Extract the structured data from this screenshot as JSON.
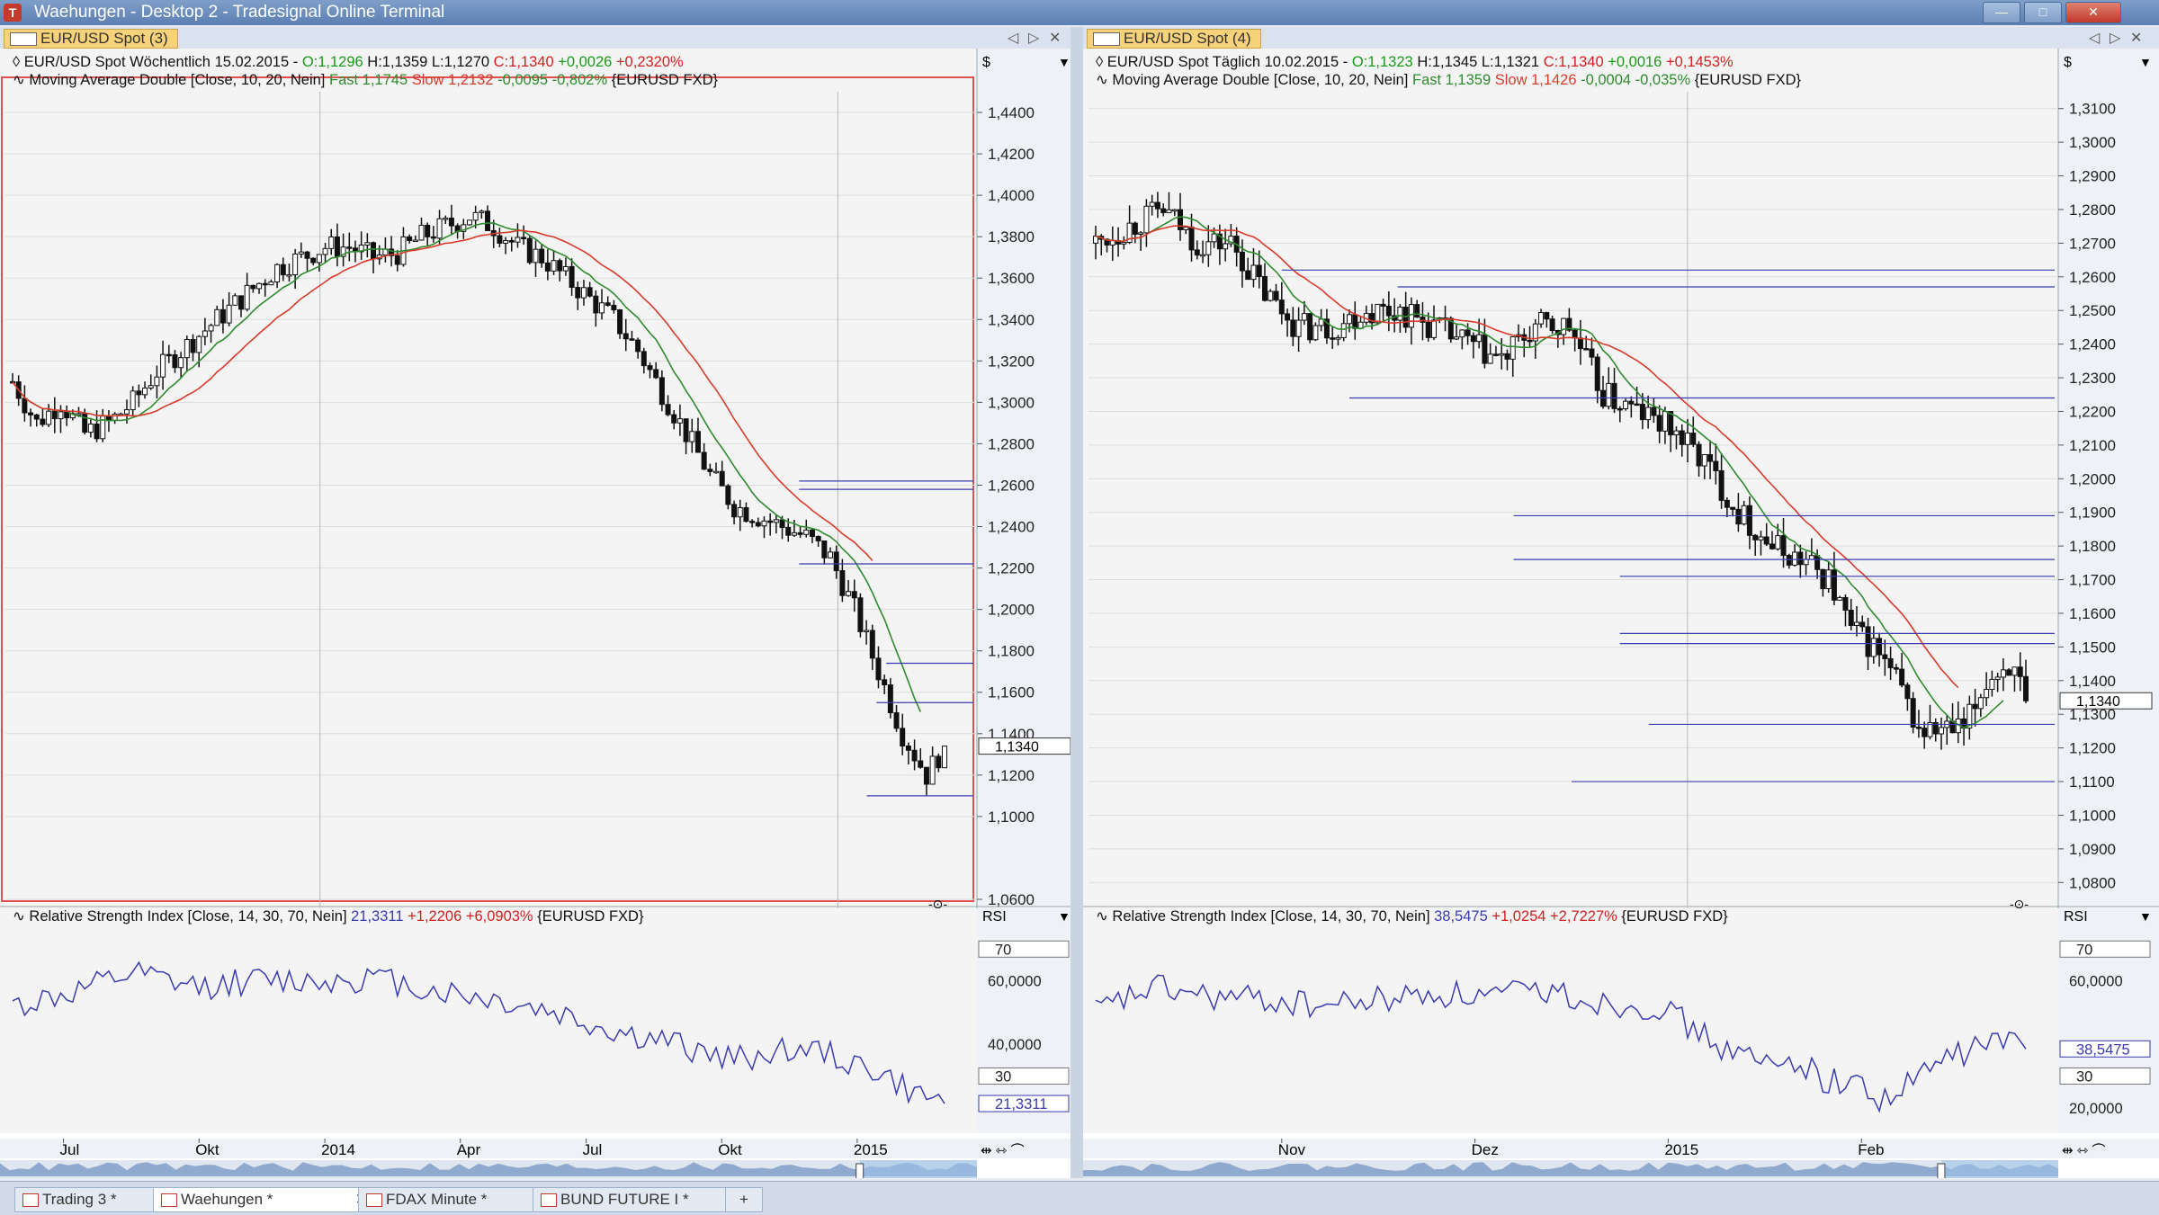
{
  "window": {
    "title": "Waehungen - Desktop 2 - Tradesignal Online Terminal",
    "controls": [
      "—",
      "□",
      "✕"
    ]
  },
  "colors": {
    "candle": "#111111",
    "ma_fast": "#2e8b2e",
    "ma_slow": "#d93b2b",
    "hline": "#3b3bb0",
    "rsi": "#3b3bb0",
    "up": "#1a9a1a",
    "down": "#d21f1f",
    "navigator": "#6e8fc0"
  },
  "panels": [
    {
      "tab": "EUR/USD Spot (3)",
      "nav": [
        "◁",
        "▷",
        "✕"
      ],
      "header": {
        "symbol": "EUR/USD Spot Wöchentlich",
        "date": "15.02.2015",
        "sep": "-",
        "O": "O:1,1296",
        "H": "H:1,1359",
        "L": "L:1,1270",
        "C": "C:1,1340",
        "chg": "+0,0026",
        "pct": "+0,2320%",
        "ma_label": "Moving Average Double [Close, 10, 20, Nein]",
        "fast": "Fast 1,1745",
        "slow": "Slow 1,2132",
        "ma_chg": "-0,0095 -0,802%",
        "feed": "{EURUSD FXD}",
        "currency": "$"
      },
      "price_ticks": [
        "1,4400",
        "1,4200",
        "1,4000",
        "1,3800",
        "1,3600",
        "1,3400",
        "1,3200",
        "1,3000",
        "1,2800",
        "1,2600",
        "1,2400",
        "1,2200",
        "1,2000",
        "1,1800",
        "1,1600",
        "1,1400",
        "1,1200",
        "1,1000",
        "1,0600"
      ],
      "last_price": "1,1340",
      "rsi": {
        "label": "Relative Strength Index [Close, 14, 30, 70, Nein]",
        "value": "21,3311",
        "chg": "+1,2206 +6,0903%",
        "feed": "{EURUSD FXD}",
        "axis_title": "RSI",
        "ticks": [
          "70",
          "60,0000",
          "40,0000",
          "30",
          "21,3311"
        ],
        "level_70": "70",
        "level_30": "30",
        "current": "21,3311"
      },
      "time_labels": [
        "Jul",
        "Okt",
        "2014",
        "Apr",
        "Jul",
        "Okt",
        "2015"
      ],
      "axis_symbol": "-⊙-"
    },
    {
      "tab": "EUR/USD Spot (4)",
      "nav": [
        "◁",
        "▷",
        "✕"
      ],
      "header": {
        "symbol": "EUR/USD Spot Täglich",
        "date": "10.02.2015",
        "sep": "-",
        "O": "O:1,1323",
        "H": "H:1,1345",
        "L": "L:1,1321",
        "C": "C:1,1340",
        "chg": "+0,0016",
        "pct": "+0,1453%",
        "ma_label": "Moving Average Double [Close, 10, 20, Nein]",
        "fast": "Fast 1,1359",
        "slow": "Slow 1,1426",
        "ma_chg": "-0,0004 -0,035%",
        "feed": "{EURUSD FXD}",
        "currency": "$"
      },
      "price_ticks": [
        "1,3100",
        "1,3000",
        "1,2900",
        "1,2800",
        "1,2700",
        "1,2600",
        "1,2500",
        "1,2400",
        "1,2300",
        "1,2200",
        "1,2100",
        "1,2000",
        "1,1900",
        "1,1800",
        "1,1700",
        "1,1600",
        "1,1500",
        "1,1400",
        "1,1300",
        "1,1200",
        "1,1100",
        "1,1000",
        "1,0900",
        "1,0800"
      ],
      "last_price": "1,1340",
      "rsi": {
        "label": "Relative Strength Index [Close, 14, 30, 70, Nein]",
        "value": "38,5475",
        "chg": "+1,0254 +2,7227%",
        "feed": "{EURUSD FXD}",
        "axis_title": "RSI",
        "ticks": [
          "70",
          "60,0000",
          "38,5475",
          "30",
          "20,0000"
        ],
        "level_70": "70",
        "level_30": "30",
        "current": "38,5475"
      },
      "time_labels": [
        "Nov",
        "Dez",
        "2015",
        "Feb"
      ],
      "axis_symbol": "-⊙-"
    }
  ],
  "workspace_tabs": [
    "Trading 3 *",
    "Waehungen *",
    "FDAX Minute *",
    "BUND FUTURE I *",
    "+"
  ],
  "chart_data": [
    {
      "type": "candlestick",
      "title": "EUR/USD Spot Wöchentlich",
      "ylim": [
        1.06,
        1.45
      ],
      "close_path": [
        [
          0,
          1.31
        ],
        [
          4,
          1.29
        ],
        [
          8,
          1.3
        ],
        [
          12,
          1.285
        ],
        [
          16,
          1.29
        ],
        [
          20,
          1.3
        ],
        [
          24,
          1.315
        ],
        [
          28,
          1.325
        ],
        [
          32,
          1.335
        ],
        [
          36,
          1.345
        ],
        [
          40,
          1.355
        ],
        [
          44,
          1.365
        ],
        [
          48,
          1.37
        ],
        [
          52,
          1.375
        ],
        [
          56,
          1.375
        ],
        [
          60,
          1.37
        ],
        [
          64,
          1.372
        ],
        [
          68,
          1.38
        ],
        [
          72,
          1.385
        ],
        [
          76,
          1.39
        ],
        [
          80,
          1.385
        ],
        [
          84,
          1.375
        ],
        [
          88,
          1.37
        ],
        [
          92,
          1.36
        ],
        [
          96,
          1.35
        ],
        [
          100,
          1.34
        ],
        [
          104,
          1.325
        ],
        [
          108,
          1.305
        ],
        [
          112,
          1.285
        ],
        [
          116,
          1.265
        ],
        [
          120,
          1.25
        ],
        [
          124,
          1.245
        ],
        [
          128,
          1.24
        ],
        [
          132,
          1.235
        ],
        [
          136,
          1.225
        ],
        [
          140,
          1.2
        ],
        [
          144,
          1.17
        ],
        [
          148,
          1.14
        ],
        [
          152,
          1.12
        ],
        [
          155,
          1.134
        ]
      ],
      "n_bars": 156,
      "last": 1.134,
      "ma_fast_last": 1.1745,
      "ma_slow_last": 1.2132,
      "levels": [
        1.262,
        1.258,
        1.222,
        1.174,
        1.155,
        1.11
      ],
      "rsi": [
        [
          0,
          52
        ],
        [
          10,
          56
        ],
        [
          20,
          62
        ],
        [
          30,
          58
        ],
        [
          40,
          60
        ],
        [
          50,
          60
        ],
        [
          60,
          61
        ],
        [
          70,
          57
        ],
        [
          80,
          54
        ],
        [
          90,
          50
        ],
        [
          100,
          44
        ],
        [
          110,
          40
        ],
        [
          120,
          35
        ],
        [
          130,
          39
        ],
        [
          135,
          37
        ],
        [
          140,
          34
        ],
        [
          145,
          30
        ],
        [
          150,
          24
        ],
        [
          155,
          21.33
        ]
      ]
    },
    {
      "type": "candlestick",
      "title": "EUR/USD Spot Täglich",
      "ylim": [
        1.075,
        1.315
      ],
      "close_path": [
        [
          0,
          1.27
        ],
        [
          6,
          1.275
        ],
        [
          12,
          1.28
        ],
        [
          18,
          1.27
        ],
        [
          24,
          1.27
        ],
        [
          30,
          1.255
        ],
        [
          36,
          1.245
        ],
        [
          42,
          1.245
        ],
        [
          48,
          1.25
        ],
        [
          54,
          1.25
        ],
        [
          60,
          1.245
        ],
        [
          66,
          1.24
        ],
        [
          72,
          1.235
        ],
        [
          78,
          1.245
        ],
        [
          84,
          1.245
        ],
        [
          90,
          1.225
        ],
        [
          96,
          1.22
        ],
        [
          102,
          1.215
        ],
        [
          108,
          1.205
        ],
        [
          114,
          1.19
        ],
        [
          120,
          1.18
        ],
        [
          126,
          1.175
        ],
        [
          130,
          1.17
        ],
        [
          134,
          1.155
        ],
        [
          138,
          1.15
        ],
        [
          142,
          1.14
        ],
        [
          146,
          1.125
        ],
        [
          150,
          1.125
        ],
        [
          154,
          1.125
        ],
        [
          158,
          1.14
        ],
        [
          162,
          1.145
        ],
        [
          165,
          1.134
        ]
      ],
      "n_bars": 166,
      "last": 1.134,
      "ma_fast_last": 1.1359,
      "ma_slow_last": 1.1426,
      "levels": [
        1.262,
        1.257,
        1.224,
        1.189,
        1.176,
        1.171,
        1.154,
        1.151,
        1.127,
        1.11
      ],
      "rsi": [
        [
          0,
          50
        ],
        [
          10,
          58
        ],
        [
          20,
          55
        ],
        [
          30,
          54
        ],
        [
          40,
          52
        ],
        [
          50,
          54
        ],
        [
          60,
          56
        ],
        [
          70,
          55
        ],
        [
          80,
          57
        ],
        [
          90,
          53
        ],
        [
          100,
          52
        ],
        [
          105,
          46
        ],
        [
          110,
          40
        ],
        [
          115,
          36
        ],
        [
          120,
          33
        ],
        [
          125,
          35
        ],
        [
          130,
          28
        ],
        [
          135,
          28
        ],
        [
          140,
          22
        ],
        [
          145,
          28
        ],
        [
          150,
          35
        ],
        [
          155,
          38
        ],
        [
          160,
          42
        ],
        [
          165,
          38.55
        ]
      ]
    }
  ]
}
